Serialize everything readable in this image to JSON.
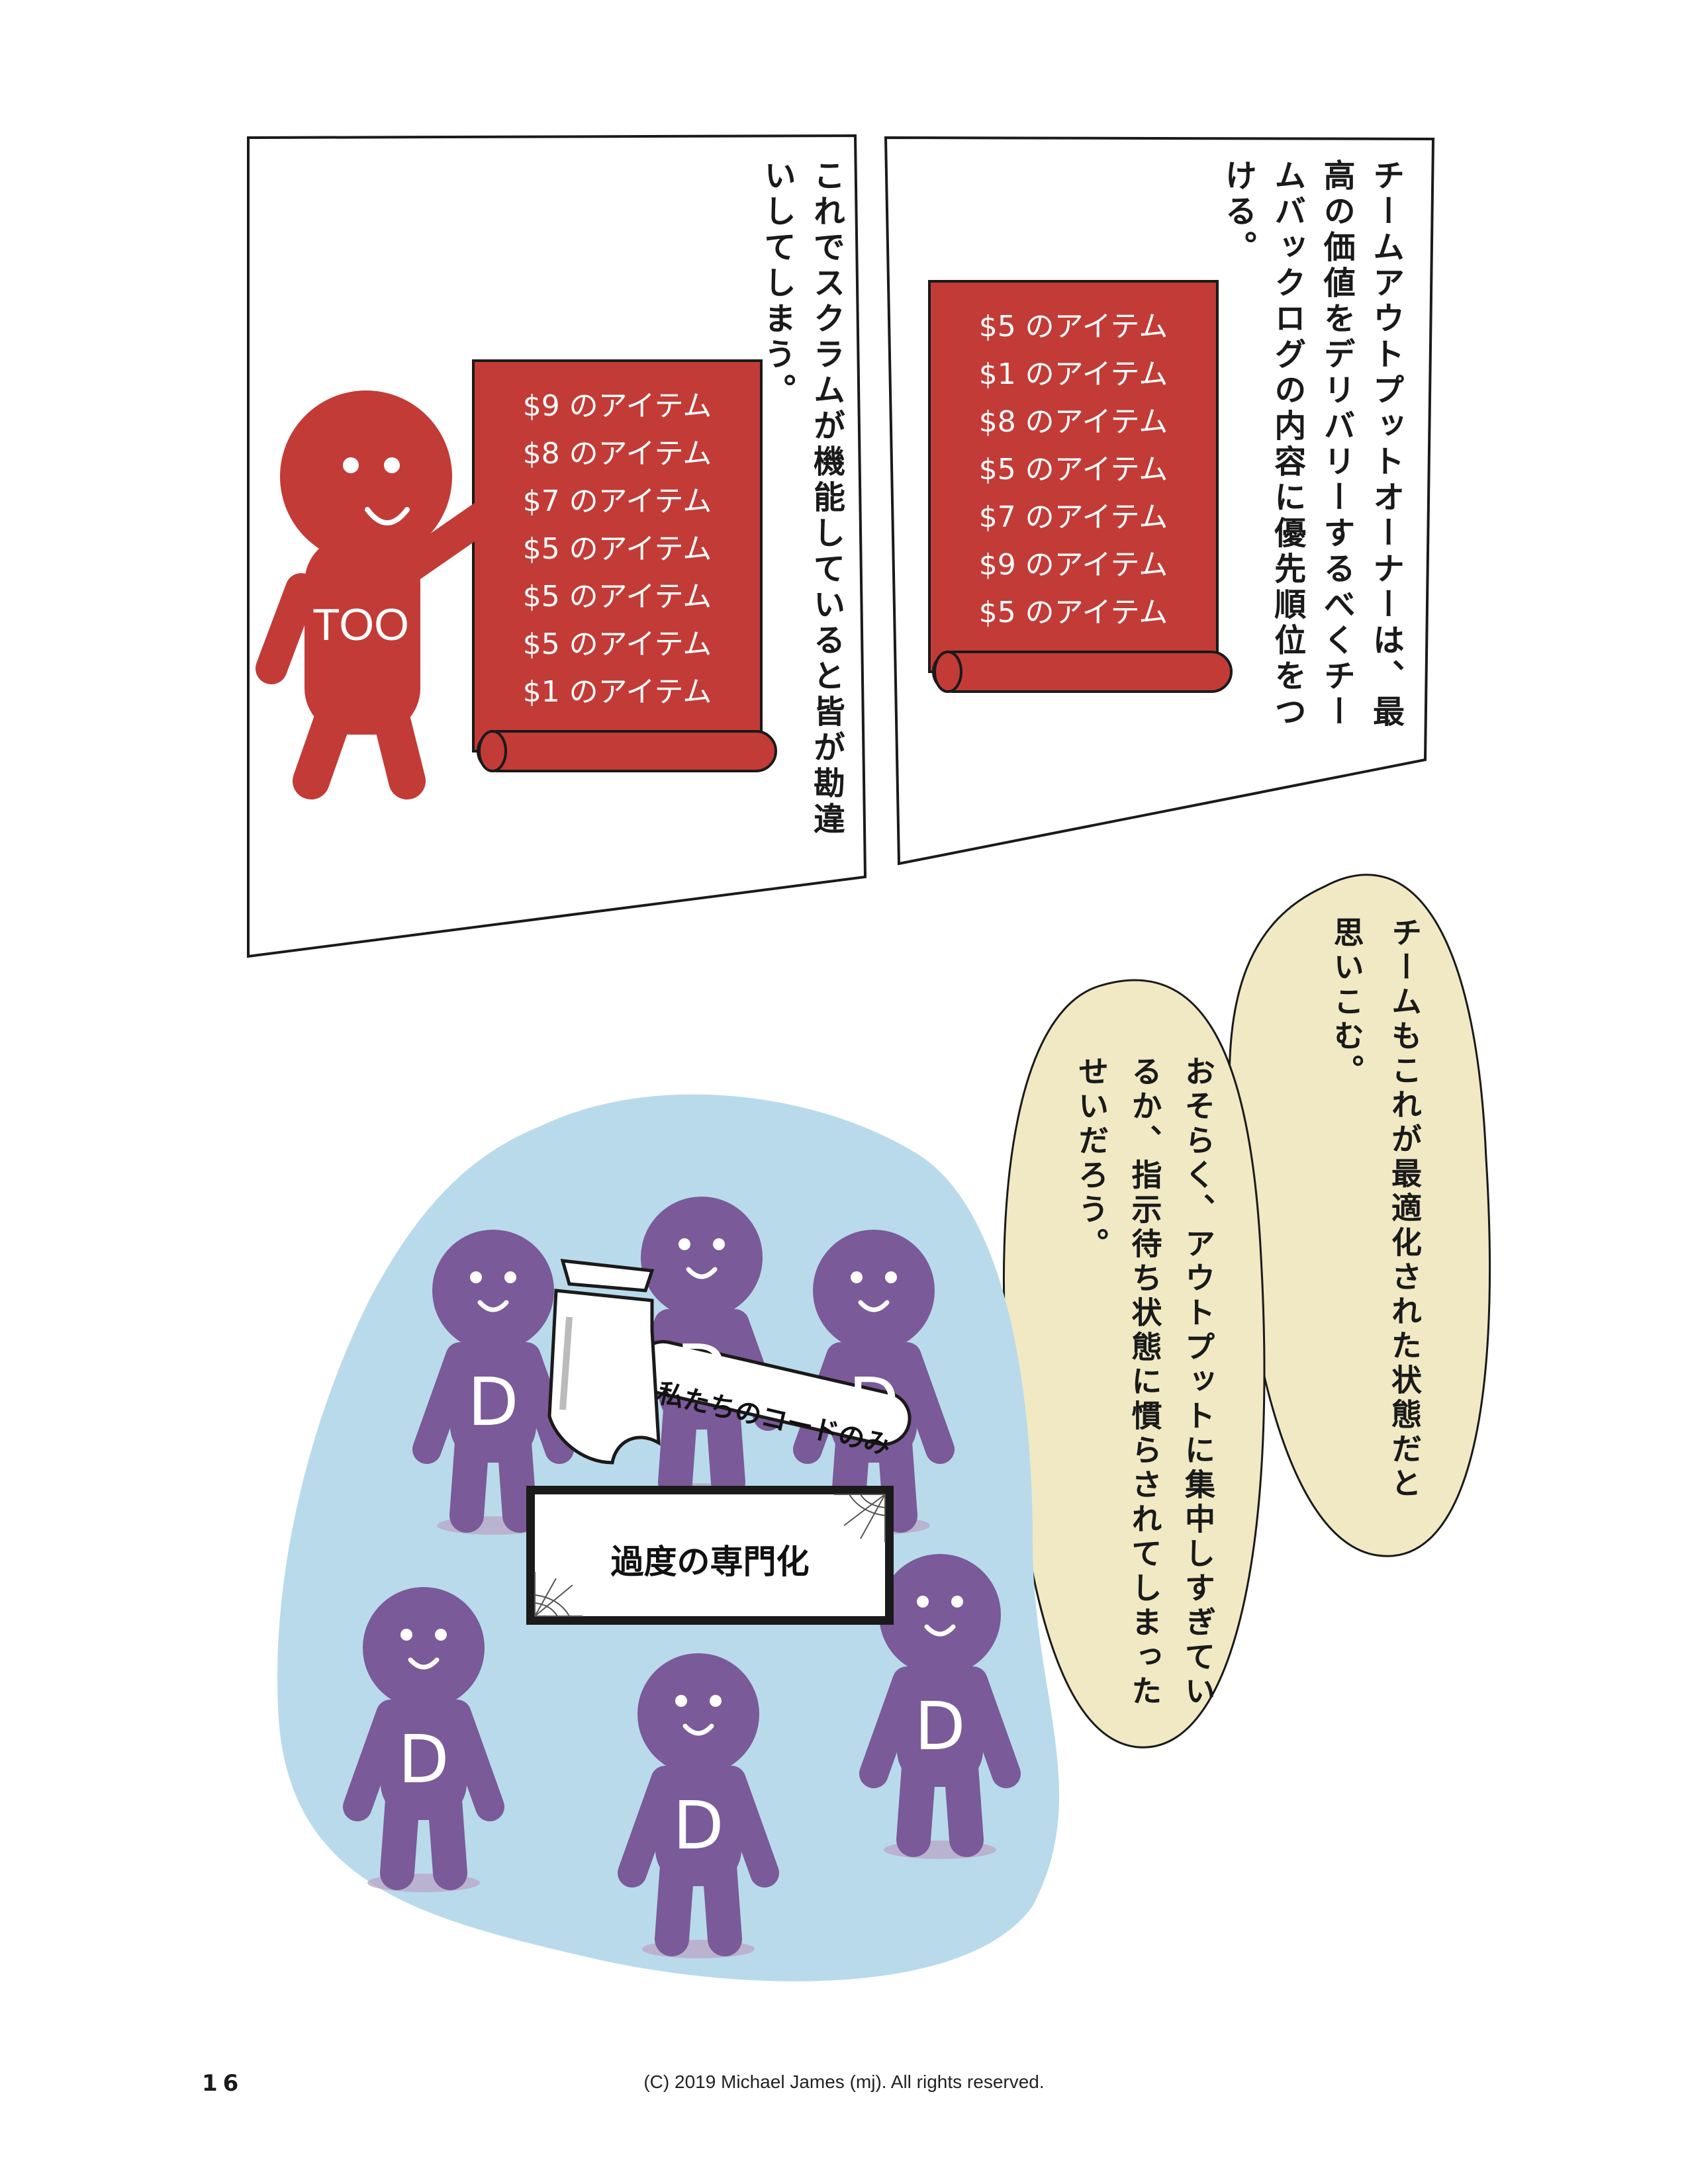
{
  "panel_right": {
    "narration": "チームアウトプットオーナーは、最高の価値をデリバリーするべくチームバックログの内容に優先順位をつける。",
    "backlog_items": [
      "$5 のアイテム",
      "$1 のアイテム",
      "$8 のアイテム",
      "$5 のアイテム",
      "$7 のアイテム",
      "$9 のアイテム",
      "$5 のアイテム"
    ]
  },
  "panel_left": {
    "narration": "これでスクラムが機能していると皆が勘違いしてしまう。",
    "backlog_items": [
      "$9 のアイテム",
      "$8 のアイテム",
      "$7 のアイテム",
      "$5 のアイテム",
      "$5 のアイテム",
      "$5 のアイテム",
      "$1 のアイテム"
    ],
    "character_label": "TOO"
  },
  "bubbles": {
    "upper": "チームもこれが最適化された状態だと思いこむ。",
    "lower": "おそらく、アウトプットに集中しすぎているか、指示待ち状態に慣らされてしまったせいだろう。"
  },
  "team_scene": {
    "developer_label": "D",
    "hammer_label": "私たちのコードのみ",
    "sign_label": "過度の専門化"
  },
  "footer": {
    "page_number": "16",
    "copyright": "(C) 2019 Michael James (mj). All rights reserved."
  },
  "colors": {
    "scroll_red": "#c23b36",
    "too_red": "#c23b36",
    "developer_purple": "#7a5a98",
    "blob_blue": "#b9daea",
    "bubble_cream": "#f0e9c4"
  }
}
